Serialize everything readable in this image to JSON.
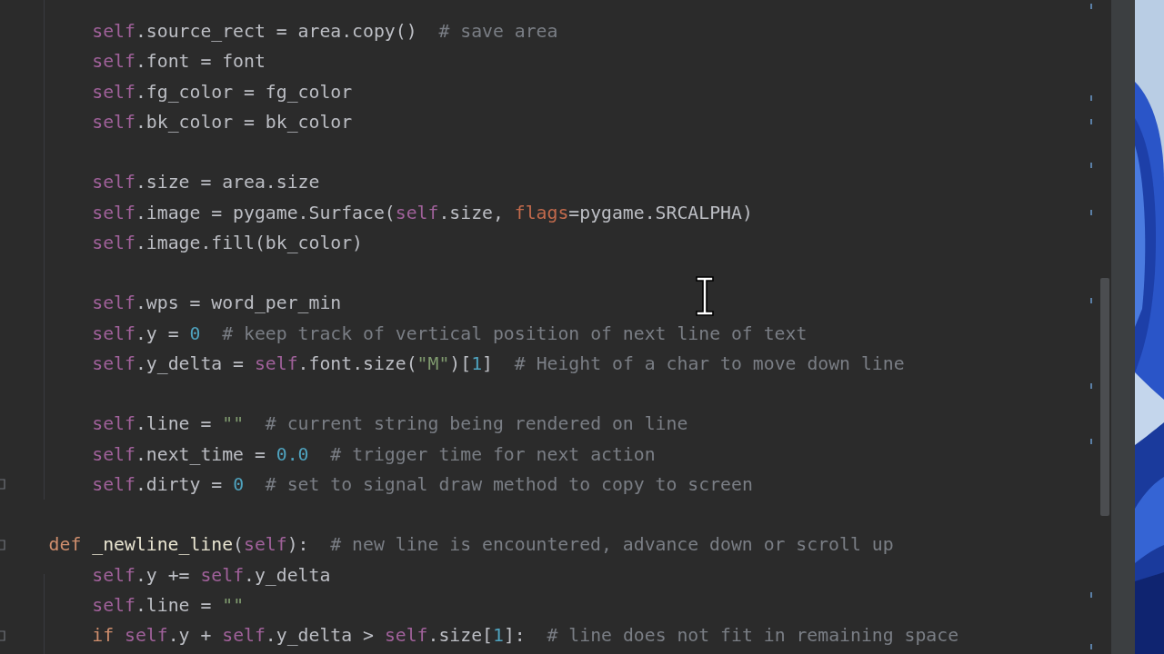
{
  "editor": {
    "lines": [
      {
        "kind": "body",
        "fold": false,
        "tokens": [
          {
            "kind": "self",
            "text": "self"
          },
          {
            "kind": "plain",
            "text": ".source_rect = area.copy()  "
          },
          {
            "kind": "comment",
            "text": "# save area"
          }
        ]
      },
      {
        "kind": "body",
        "fold": false,
        "tokens": [
          {
            "kind": "self",
            "text": "self"
          },
          {
            "kind": "plain",
            "text": ".font = font"
          }
        ]
      },
      {
        "kind": "body",
        "fold": false,
        "tokens": [
          {
            "kind": "self",
            "text": "self"
          },
          {
            "kind": "plain",
            "text": ".fg_color = fg_color"
          }
        ]
      },
      {
        "kind": "body",
        "fold": false,
        "tokens": [
          {
            "kind": "self",
            "text": "self"
          },
          {
            "kind": "plain",
            "text": ".bk_color = bk_color"
          }
        ]
      },
      {
        "kind": "blank"
      },
      {
        "kind": "body",
        "fold": false,
        "tokens": [
          {
            "kind": "self",
            "text": "self"
          },
          {
            "kind": "plain",
            "text": ".size = area.size"
          }
        ]
      },
      {
        "kind": "body",
        "fold": false,
        "tokens": [
          {
            "kind": "self",
            "text": "self"
          },
          {
            "kind": "plain",
            "text": ".image = pygame.Surface("
          },
          {
            "kind": "self",
            "text": "self"
          },
          {
            "kind": "plain",
            "text": ".size, "
          },
          {
            "kind": "param",
            "text": "flags"
          },
          {
            "kind": "plain",
            "text": "=pygame.SRCALPHA)"
          }
        ]
      },
      {
        "kind": "body",
        "fold": false,
        "tokens": [
          {
            "kind": "self",
            "text": "self"
          },
          {
            "kind": "plain",
            "text": ".image.fill(bk_color)"
          }
        ]
      },
      {
        "kind": "blank"
      },
      {
        "kind": "body",
        "fold": false,
        "tokens": [
          {
            "kind": "self",
            "text": "self"
          },
          {
            "kind": "plain",
            "text": ".wps = word_per_min"
          }
        ]
      },
      {
        "kind": "body",
        "fold": false,
        "tokens": [
          {
            "kind": "self",
            "text": "self"
          },
          {
            "kind": "plain",
            "text": ".y = "
          },
          {
            "kind": "number",
            "text": "0"
          },
          {
            "kind": "comment",
            "text": "  # keep track of vertical position of next line of text"
          }
        ]
      },
      {
        "kind": "body",
        "fold": false,
        "tokens": [
          {
            "kind": "self",
            "text": "self"
          },
          {
            "kind": "plain",
            "text": ".y_delta = "
          },
          {
            "kind": "self",
            "text": "self"
          },
          {
            "kind": "plain",
            "text": ".font.size("
          },
          {
            "kind": "string",
            "text": "\"M\""
          },
          {
            "kind": "plain",
            "text": ")["
          },
          {
            "kind": "number",
            "text": "1"
          },
          {
            "kind": "plain",
            "text": "]  "
          },
          {
            "kind": "comment",
            "text": "# Height of a char to move down line"
          }
        ]
      },
      {
        "kind": "blank"
      },
      {
        "kind": "body",
        "fold": false,
        "tokens": [
          {
            "kind": "self",
            "text": "self"
          },
          {
            "kind": "plain",
            "text": ".line = "
          },
          {
            "kind": "string",
            "text": "\"\""
          },
          {
            "kind": "comment",
            "text": "  # current string being rendered on line"
          }
        ]
      },
      {
        "kind": "body",
        "fold": false,
        "tokens": [
          {
            "kind": "self",
            "text": "self"
          },
          {
            "kind": "plain",
            "text": ".next_time = "
          },
          {
            "kind": "number",
            "text": "0.0"
          },
          {
            "kind": "comment",
            "text": "  # trigger time for next action"
          }
        ]
      },
      {
        "kind": "body",
        "fold": true,
        "tokens": [
          {
            "kind": "self",
            "text": "self"
          },
          {
            "kind": "plain",
            "text": ".dirty = "
          },
          {
            "kind": "number",
            "text": "0"
          },
          {
            "kind": "comment",
            "text": "  # set to signal draw method to copy to screen"
          }
        ]
      },
      {
        "kind": "blank"
      },
      {
        "kind": "def",
        "fold": true,
        "tokens": [
          {
            "kind": "keyword",
            "text": "def "
          },
          {
            "kind": "funcname",
            "text": "_newline_line"
          },
          {
            "kind": "plain",
            "text": "("
          },
          {
            "kind": "self",
            "text": "self"
          },
          {
            "kind": "plain",
            "text": "):  "
          },
          {
            "kind": "comment",
            "text": "# new line is encountered, advance down or scroll up"
          }
        ]
      },
      {
        "kind": "body",
        "fold": false,
        "tokens": [
          {
            "kind": "self",
            "text": "self"
          },
          {
            "kind": "plain",
            "text": ".y += "
          },
          {
            "kind": "self",
            "text": "self"
          },
          {
            "kind": "plain",
            "text": ".y_delta"
          }
        ]
      },
      {
        "kind": "body",
        "fold": false,
        "tokens": [
          {
            "kind": "self",
            "text": "self"
          },
          {
            "kind": "plain",
            "text": ".line = "
          },
          {
            "kind": "string",
            "text": "\"\""
          }
        ]
      },
      {
        "kind": "body",
        "fold": true,
        "tokens": [
          {
            "kind": "keyword",
            "text": "if "
          },
          {
            "kind": "self",
            "text": "self"
          },
          {
            "kind": "plain",
            "text": ".y + "
          },
          {
            "kind": "self",
            "text": "self"
          },
          {
            "kind": "plain",
            "text": ".y_delta > "
          },
          {
            "kind": "self",
            "text": "self"
          },
          {
            "kind": "plain",
            "text": ".size["
          },
          {
            "kind": "number",
            "text": "1"
          },
          {
            "kind": "plain",
            "text": "]:  "
          },
          {
            "kind": "comment",
            "text": "# line does not fit in remaining space"
          }
        ]
      }
    ]
  }
}
